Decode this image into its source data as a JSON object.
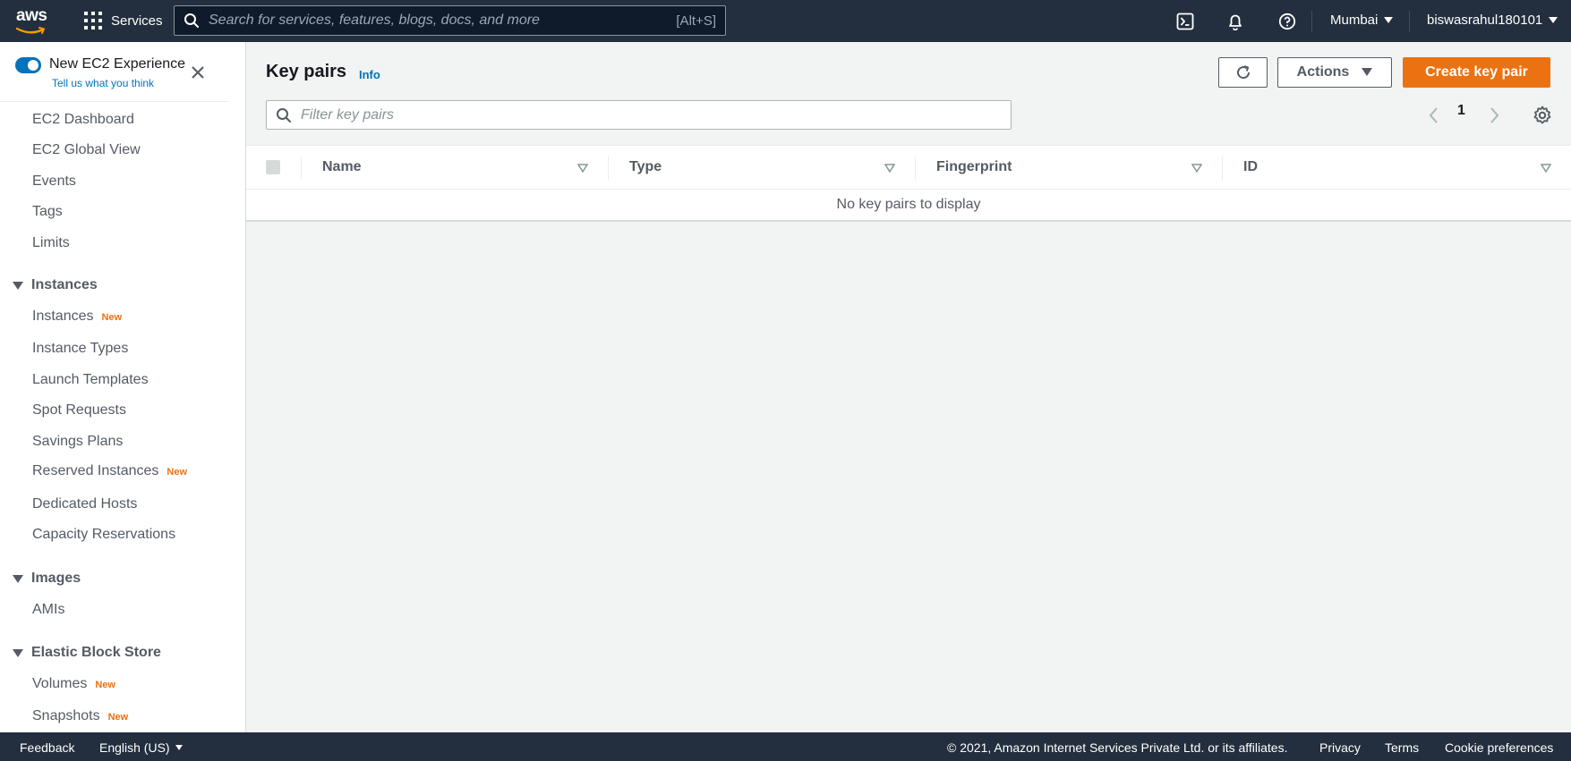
{
  "topnav": {
    "logo_text": "aws",
    "services_label": "Services",
    "search_placeholder": "Search for services, features, blogs, docs, and more",
    "search_shortcut": "[Alt+S]",
    "region": "Mumbai",
    "account": "biswasrahul180101"
  },
  "sidebar": {
    "title": "New EC2 Experience",
    "subtitle": "Tell us what you think",
    "top_items": [
      "EC2 Dashboard",
      "EC2 Global View",
      "Events",
      "Tags",
      "Limits"
    ],
    "sections": [
      {
        "title": "Instances",
        "items": [
          {
            "label": "Instances",
            "badge": "New"
          },
          {
            "label": "Instance Types",
            "badge": ""
          },
          {
            "label": "Launch Templates",
            "badge": ""
          },
          {
            "label": "Spot Requests",
            "badge": ""
          },
          {
            "label": "Savings Plans",
            "badge": ""
          },
          {
            "label": "Reserved Instances",
            "badge": "New"
          },
          {
            "label": "Dedicated Hosts",
            "badge": ""
          },
          {
            "label": "Capacity Reservations",
            "badge": ""
          }
        ]
      },
      {
        "title": "Images",
        "items": [
          {
            "label": "AMIs",
            "badge": ""
          }
        ]
      },
      {
        "title": "Elastic Block Store",
        "items": [
          {
            "label": "Volumes",
            "badge": "New"
          },
          {
            "label": "Snapshots",
            "badge": "New"
          }
        ]
      }
    ]
  },
  "main": {
    "title": "Key pairs",
    "info_label": "Info",
    "actions_label": "Actions",
    "create_label": "Create key pair",
    "filter_placeholder": "Filter key pairs",
    "page_number": "1",
    "columns": [
      "Name",
      "Type",
      "Fingerprint",
      "ID"
    ],
    "empty_message": "No key pairs to display"
  },
  "footer": {
    "feedback": "Feedback",
    "language": "English (US)",
    "copyright": "© 2021, Amazon Internet Services Private Ltd. or its affiliates.",
    "privacy": "Privacy",
    "terms": "Terms",
    "cookies": "Cookie preferences"
  },
  "colors": {
    "nav_bg": "#232f3e",
    "primary_orange": "#ec7211",
    "link_blue": "#0073bb",
    "badge_orange": "#ec7211"
  }
}
